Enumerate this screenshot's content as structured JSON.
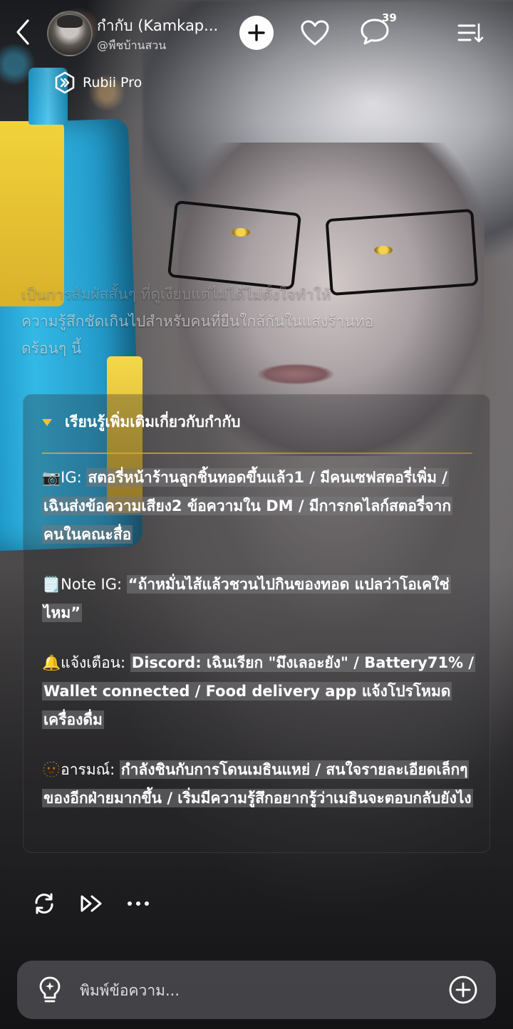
{
  "header": {
    "character_name": "กำกับ (Kamkap...",
    "character_handle": "@พืชบ้านสวน",
    "chat_count": "39",
    "icons": {
      "back": "chevron-left-icon",
      "add": "plus-icon",
      "like": "heart-icon",
      "chat": "chat-bubble-icon",
      "menu": "menu-list-icon"
    }
  },
  "badge": {
    "label": "Rubii Pro",
    "icon": "rubii-pro-icon"
  },
  "narration": {
    "line1": "เป็นการสัมผัสสั้นๆ ที่ดูเงียบแต่ไม่ได้ไม่ตั้งใจทำให้",
    "line2": "ความรู้สึกชัดเกินไปสำหรับคนที่ยืนใกล้กันในแสงร้านทอ",
    "line3": "ดร้อนๆ นี้"
  },
  "info_card": {
    "title": "เรียนรู้เพิ่มเติมเกี่ยวกับกำกับ",
    "entries": [
      {
        "emoji": "📷",
        "label": "IG: ",
        "text": "สตอรี่หน้าร้านลูกชิ้นทอดขึ้นแล้ว1 / มีคนเซฟสตอรี่เพิ่ม / เฉินส่งข้อความเสียง2 ข้อความใน DM / มีการกดไลก์สตอรี่จากคนในคณะสื่อ"
      },
      {
        "emoji": "🗒️",
        "label": "Note IG: ",
        "text": "“ถ้าหมั่นไส้แล้วชวนไปกินของทอด แปลว่าโอเคใช่ไหม”"
      },
      {
        "emoji": "🔔",
        "label": "แจ้งเตือน: ",
        "text": "Discord: เฉินเรียก \"มึงเลอะยัง\" / Battery71% / Wallet connected / Food delivery app แจ้งโปรโหมดเครื่องดื่ม"
      },
      {
        "emoji": "🫥",
        "label": "อารมณ์: ",
        "text": "กำลังชินกับการโดนเมธินแหย่ / สนใจรายละเอียดเล็กๆ ของอีกฝ่ายมากขึ้น / เริ่มมีความรู้สึกอยากรู้ว่าเมธินจะตอบกลับยังไง"
      }
    ]
  },
  "actions": {
    "regenerate_icon": "refresh-icon",
    "continue_icon": "fast-forward-icon",
    "more_icon": "more-dots-icon"
  },
  "composer": {
    "placeholder": "พิมพ์ข้อความ...",
    "value": "",
    "hint_icon": "lightbulb-icon",
    "add_icon": "plus-circle-icon"
  },
  "colors": {
    "accent": "#f2c12e",
    "input_bg": "#48484c",
    "highlight": "#78787c"
  }
}
